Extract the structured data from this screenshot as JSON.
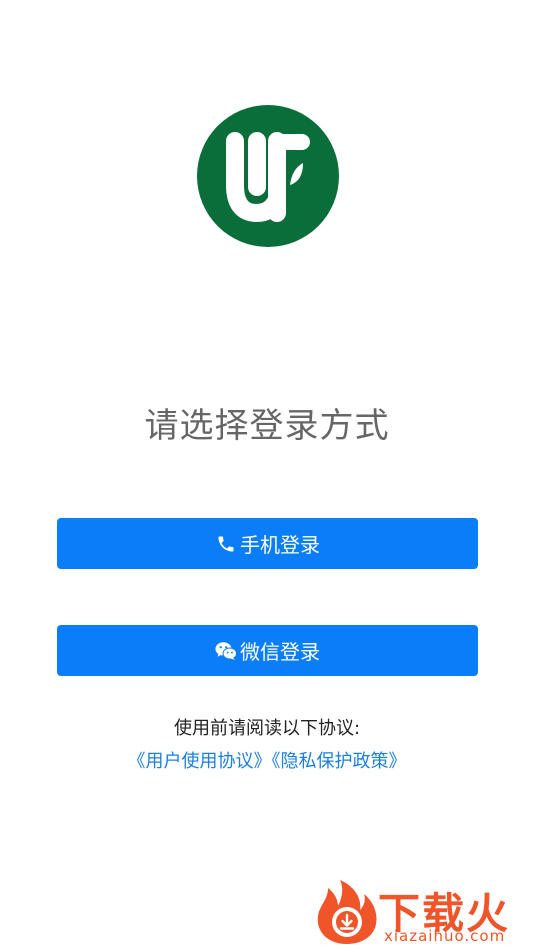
{
  "logo": {
    "icon": "uf-logo-icon",
    "color": "#0a6e3a"
  },
  "title": "请选择登录方式",
  "buttons": {
    "phone": {
      "label": "手机登录",
      "icon": "phone-icon"
    },
    "wechat": {
      "label": "微信登录",
      "icon": "wechat-icon"
    }
  },
  "agreement": {
    "prompt": "使用前请阅读以下协议:",
    "user_agreement": "《用户使用协议》",
    "privacy_policy": "《隐私保护政策》"
  },
  "watermark": {
    "name": "下载火",
    "url": "xiazaihuo.com"
  },
  "colors": {
    "accent": "#0a7df8",
    "link": "#1a7fe0",
    "brand_green": "#0a6e3a",
    "watermark": "#f0552a"
  }
}
